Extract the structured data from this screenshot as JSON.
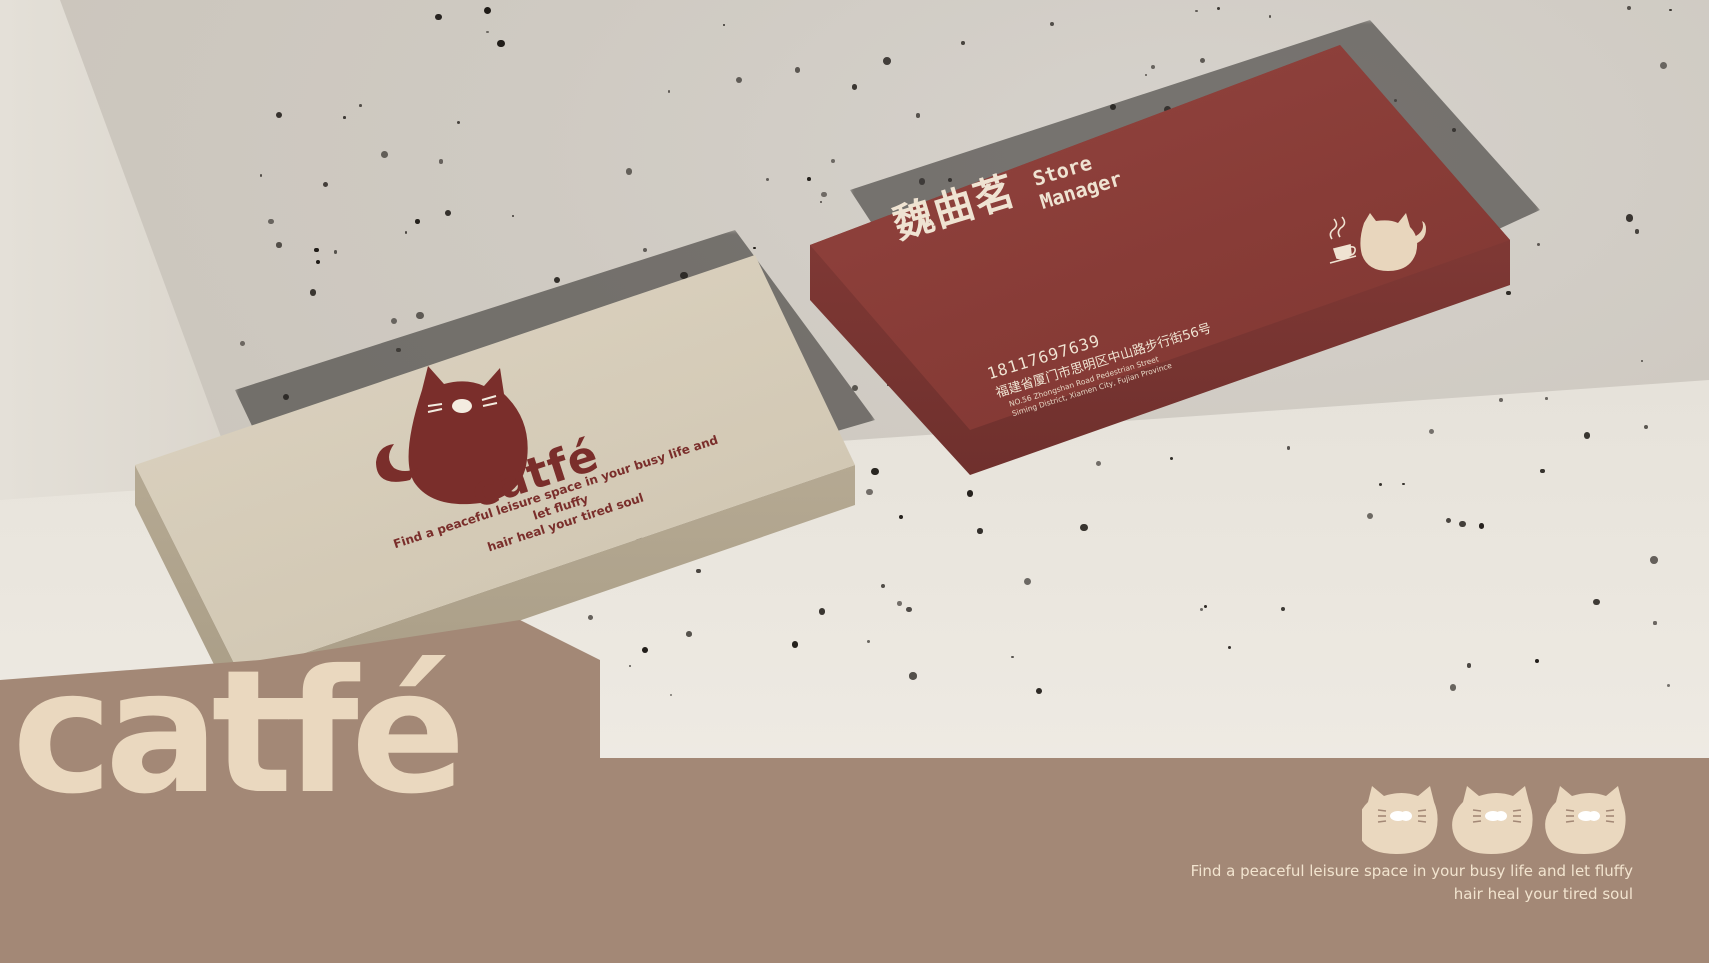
{
  "colors": {
    "band": "#a38876",
    "cream": "#ead8bf",
    "card_red": "#883c37",
    "card_cream": "#d2c8b4",
    "logo_red": "#7a2e2b"
  },
  "cream_card": {
    "logo": "catfé",
    "tagline_line1": "Find a peaceful leisure space in your busy life and let fluffy",
    "tagline_line2": "hair heal your tired soul",
    "icon": "cat-silhouette-icon"
  },
  "red_card": {
    "name": "魏曲茗",
    "role_line1": "Store",
    "role_line2": "Manager",
    "phone": "18117697639",
    "address_cn": "福建省厦门市思明区中山路步行街56号",
    "address_en_line1": "NO.56 Zhongshan Road Pedestrian Street",
    "address_en_line2": "Siming District, Xiamen City, Fujian Province",
    "icons": [
      "coffee-cup-icon",
      "cat-silhouette-icon"
    ]
  },
  "banner": {
    "logo": "catfé",
    "tagline_line1": "Find a peaceful leisure space in your busy life and let fluffy",
    "tagline_line2": "hair heal your tired soul",
    "icons": [
      "cat-head-icon",
      "cat-head-icon",
      "cat-head-icon"
    ]
  }
}
